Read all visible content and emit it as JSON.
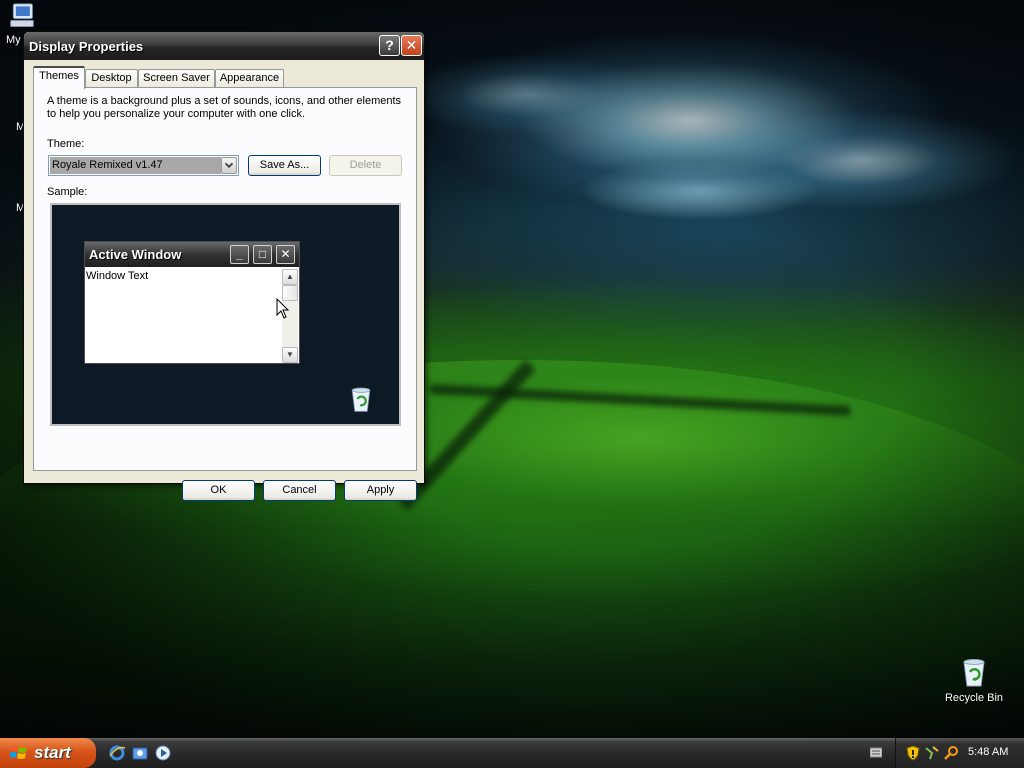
{
  "desktop": {
    "icons": [
      {
        "label_partial": "My"
      },
      {
        "label": "Recycle Bin"
      }
    ],
    "clipped_labels": [
      "M",
      "M"
    ]
  },
  "dialog": {
    "title": "Display Properties",
    "help_glyph": "?",
    "close_glyph": "✕",
    "tabs": [
      {
        "label": "Themes",
        "active": true
      },
      {
        "label": "Desktop",
        "active": false
      },
      {
        "label": "Screen Saver",
        "active": false
      },
      {
        "label": "Appearance",
        "active": false
      }
    ],
    "description": "A theme is a background plus a set of sounds, icons, and other elements to help you personalize your computer with one click.",
    "theme_label": "Theme:",
    "theme_value": "Royale Remixed v1.47",
    "save_as_label": "Save As...",
    "delete_label": "Delete",
    "sample_label": "Sample:",
    "sample": {
      "window_title": "Active Window",
      "window_text": "Window Text"
    },
    "ok_label": "OK",
    "cancel_label": "Cancel",
    "apply_label": "Apply"
  },
  "taskbar": {
    "start_label": "start",
    "quick_launch": [
      "internet-explorer-icon",
      "outlook-express-icon",
      "media-player-icon"
    ],
    "tray_icons": [
      "keyboard-icon",
      "security-shield-icon",
      "network-icon",
      "search-icon"
    ],
    "clock": "5:48 AM"
  },
  "colors": {
    "titlebar": "#262626",
    "start_button": "#d8551a",
    "dialog_face": "#ece9d8",
    "close_button": "#c4401d"
  }
}
